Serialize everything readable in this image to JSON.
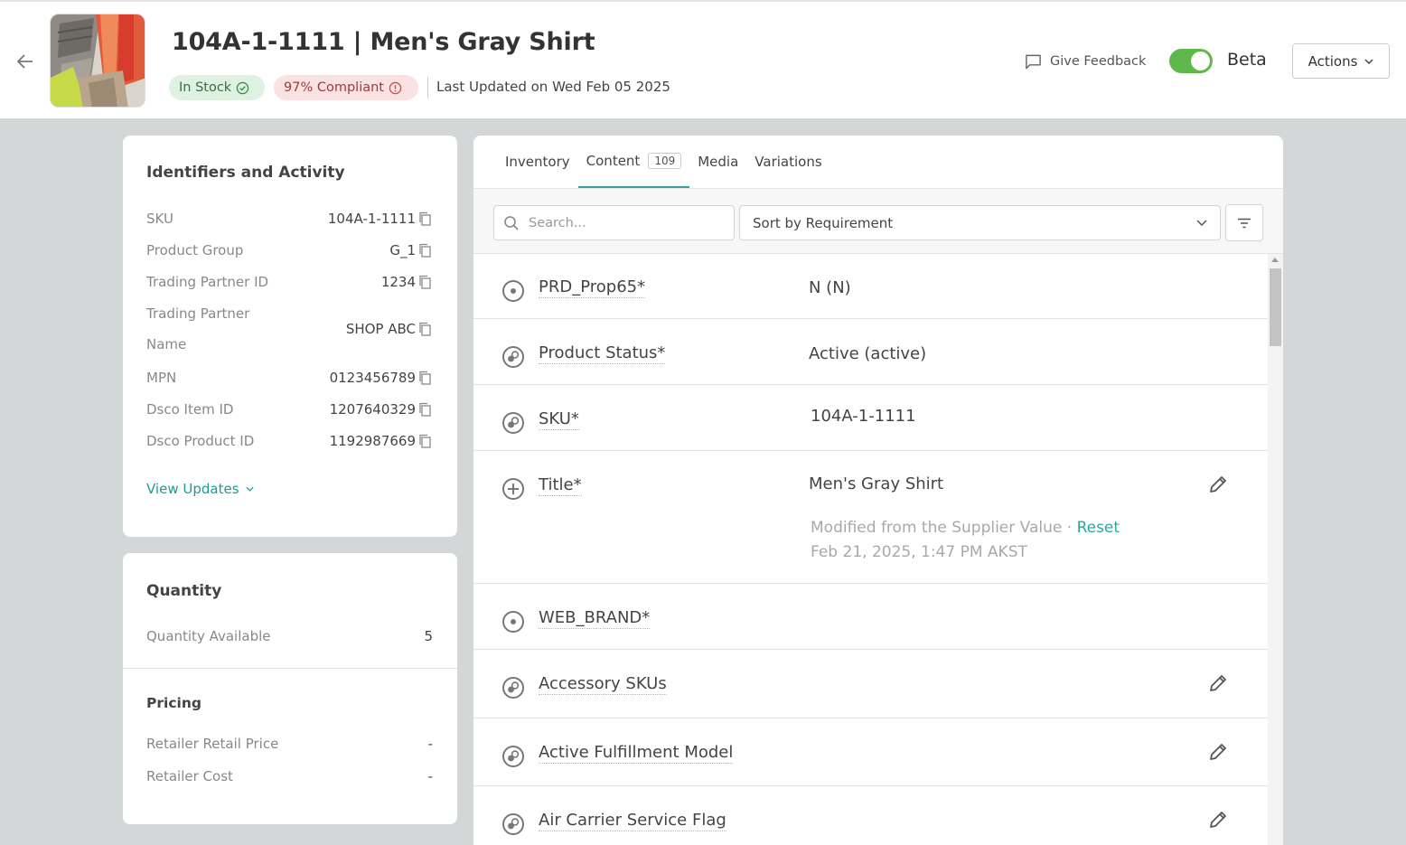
{
  "header": {
    "title": "104A-1-1111 | Men's Gray Shirt",
    "badges": {
      "stock": "In Stock",
      "compliance": "97% Compliant"
    },
    "last_updated": "Last Updated on Wed Feb 05 2025",
    "feedback_label": "Give Feedback",
    "beta_label": "Beta",
    "beta_enabled": true,
    "actions_label": "Actions"
  },
  "identifiers": {
    "heading": "Identifiers and Activity",
    "items": [
      {
        "label": "SKU",
        "value": "104A-1-1111"
      },
      {
        "label": "Product Group",
        "value": "G_1"
      },
      {
        "label": "Trading Partner ID",
        "value": "1234"
      },
      {
        "label": "Trading Partner",
        "label_line2": "Name",
        "value": "SHOP ABC"
      },
      {
        "label": "MPN",
        "value": "0123456789"
      },
      {
        "label": "Dsco Item ID",
        "value": "1207640329"
      },
      {
        "label": "Dsco Product ID",
        "value": "1192987669"
      }
    ],
    "view_updates": "View Updates"
  },
  "quantity": {
    "heading": "Quantity",
    "available_label": "Quantity Available",
    "available_value": "5",
    "pricing_heading": "Pricing",
    "retail_price_label": "Retailer Retail Price",
    "retail_price_value": "-",
    "cost_label": "Retailer Cost",
    "cost_value": "-"
  },
  "tabs": [
    {
      "label": "Inventory"
    },
    {
      "label": "Content",
      "count": "109",
      "active": true
    },
    {
      "label": "Media"
    },
    {
      "label": "Variations"
    }
  ],
  "toolbar": {
    "search_placeholder": "Search...",
    "sort_label": "Sort by Requirement"
  },
  "attributes": [
    {
      "icon": "target-icon",
      "label": "PRD_Prop65*",
      "value": "N (N)",
      "editable": false
    },
    {
      "icon": "linked-circles-icon",
      "label": "Product Status*",
      "value": "Active (active)",
      "editable": false
    },
    {
      "icon": "linked-circles-icon",
      "label": "SKU*",
      "value": "104A-1-1111",
      "editable": false
    },
    {
      "icon": "plus-circle-icon",
      "label": "Title*",
      "value": "Men's Gray Shirt",
      "editable": true,
      "modified_text": "Modified from the Supplier Value · ",
      "reset_label": "Reset",
      "modified_date": "Feb 21, 2025, 1:47 PM AKST"
    },
    {
      "icon": "target-icon",
      "label": "WEB_BRAND*",
      "value": "",
      "editable": false
    },
    {
      "icon": "linked-circles-icon",
      "label": "Accessory SKUs",
      "value": "",
      "editable": true
    },
    {
      "icon": "linked-circles-icon",
      "label": "Active Fulfillment Model",
      "value": "",
      "editable": true
    },
    {
      "icon": "linked-circles-icon",
      "label": "Air Carrier Service Flag",
      "value": "",
      "editable": true
    }
  ]
}
